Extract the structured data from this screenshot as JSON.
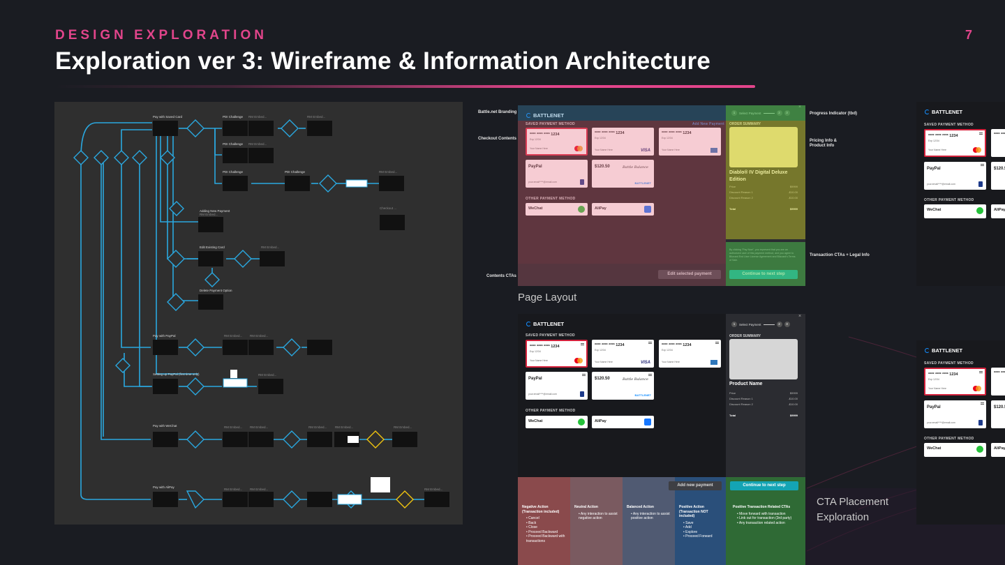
{
  "header": {
    "eyebrow": "DESIGN EXPLORATION",
    "title": "Exploration ver 3: Wireframe & Information Architecture",
    "page_number": "7"
  },
  "colors": {
    "accent": "#e2458b",
    "background": "#1a1c22",
    "flow_panel": "#2f2f2f",
    "flow_lines": "#2aa8e0",
    "flow_highlight": "#f1c40f",
    "teal": "#14a4b4",
    "card_red": "#d4213b"
  },
  "flowchart": {
    "nodes": {
      "saved_card": "Pay with Saved Card",
      "pdi_challenge": "PDI Challenge",
      "rm_embed": "RM Embed...",
      "adding_new_payment": "Adding New Payment",
      "edit_existing_card": "Edit Existing Card",
      "delete_payment_option": "Delete Payment Option",
      "pay_with_paypal": "Pay with PayPal",
      "setting_up_paypal": "Setting up PayPal (first time only)",
      "pay_with_wechat": "Pay with WeChat",
      "pay_with_alipay": "Pay with AliPay",
      "checkout": "Checkout ..."
    }
  },
  "annotations": {
    "branding": "Battle.net Branding",
    "checkout_contents": "Checkout Contents",
    "contents_ctas": "Contents CTAs",
    "progress_indicator": "Progress Indicator (tbd)",
    "pricing_info": "Pricing Info & Product Info",
    "transaction_ctas": "Transaction CTAs + Legal Info"
  },
  "captions": {
    "page_layout": "Page Layout",
    "cta_placement": "CTA Placement Exploration"
  },
  "checkout": {
    "brand": "BATTLENET",
    "saved_payment_method": "SAVED PAYMENT METHOD",
    "add_new_payment_link": "Add New Payment",
    "other_payment_method": "OTHER PAYMENT METHOD",
    "order_summary": "ORDER SUMMARY",
    "stepper": {
      "step1": "1",
      "label": "Select Payment",
      "step2": "2",
      "step3": "3"
    },
    "cards": [
      {
        "number": "**** **** **** 1234",
        "exp": "Exp 12/34",
        "name": "Your Name Here",
        "brand": "mastercard"
      },
      {
        "number": "**** **** **** 1234",
        "exp": "Exp 12/34",
        "name": "Your Name Here",
        "brand": "VISA"
      },
      {
        "number": "**** **** **** 1234",
        "exp": "Exp 12/34",
        "name": "Your Name Here",
        "brand": "amex"
      }
    ],
    "paypal": {
      "label": "PayPal",
      "email": "your.email****@email.com"
    },
    "balance": {
      "amount": "$120.50",
      "script": "Battle Balance",
      "brand": "BATTLENET"
    },
    "wechat": "WeChat",
    "alipay": "AliPay",
    "product_a": "Diablo® IV Digital Deluxe Edition",
    "product_b": "Product Name",
    "price_rows": [
      {
        "label": "Price",
        "value": "$9999"
      },
      {
        "label": "Discount Reason 1",
        "value": "-$10.00"
      },
      {
        "label": "Discount Reason 2",
        "value": "-$10.00"
      }
    ],
    "total": {
      "label": "Total",
      "value": "$9999"
    },
    "legal": "By clicking \"Pay Now\", you represent that you are an authorized user of this payment method, and you agree to Blizzard End User License Agreement and Blizzard's Terms of Sale.",
    "edit_selected_payment": "Edit selected payment",
    "continue_next_step": "Continue to next step",
    "add_new_payment": "Add new payment"
  },
  "cta_columns": [
    {
      "title": "Negative Action (Transaction included)",
      "items": [
        "Cancel",
        "Back",
        "Close",
        "Proceed Backward",
        "Proceed Backward with transactions"
      ],
      "color": "#8a4a4c"
    },
    {
      "title": "Neutral Action",
      "items": [
        "Any interaction to assist negative action"
      ],
      "color": "#7a5a60"
    },
    {
      "title": "Balanced Action",
      "items": [
        "Any interaction to assist positive action"
      ],
      "color": "#505a72"
    },
    {
      "title": "Positive Action (Transaction NOT included)",
      "items": [
        "Save",
        "Add",
        "Explore",
        "Proceed Forward"
      ],
      "color": "#2a4f7a"
    },
    {
      "title": "Positive Transaction Related CTAs",
      "items": [
        "Move forward with transaction",
        "Link out for transaction (3rd party)",
        "Any transaction related action"
      ],
      "color": "#2f6a35"
    }
  ]
}
